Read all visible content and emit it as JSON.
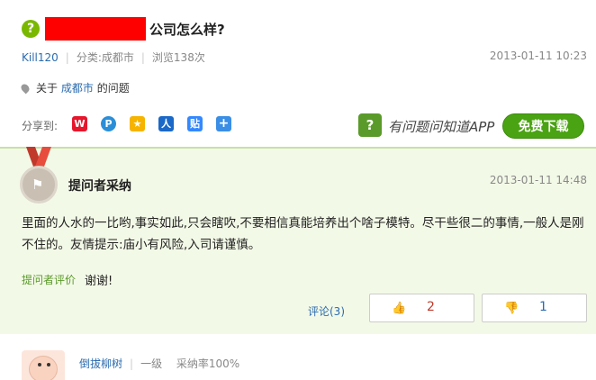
{
  "question": {
    "icon_glyph": "?",
    "title": "公司怎么样?",
    "redaction_color": "#ff0000"
  },
  "meta": {
    "user": "Kill120",
    "category": "分类:成都市",
    "views": "浏览138次",
    "time": "2013-01-11 10:23"
  },
  "about": {
    "prefix": "关于",
    "city": "成都市",
    "suffix": "的问题"
  },
  "share": {
    "label": "分享到:",
    "icons": [
      "weibo-icon",
      "qq-weibo-icon",
      "qzone-icon",
      "renren-icon",
      "tieba-icon",
      "more-share-icon"
    ]
  },
  "app": {
    "icon_glyph": "?",
    "text": "有问题问知道APP",
    "download_label": "免费下载",
    "accent": "#4aa312"
  },
  "best_answer": {
    "title": "提问者采纳",
    "time": "2013-01-11 14:48",
    "text": "里面的人水的一比哟,事实如此,只会瞎吹,不要相信真能培养出个啥子模特。尽干些很二的事情,一般人是刚不住的。友情提示:庙小有风险,入司请谨慎。",
    "eval_label": "提问者评价",
    "eval_text": "谢谢!",
    "comment_label": "评论(3)",
    "up_count": "2",
    "down_count": "1",
    "panel_color": "#f3f9e7"
  },
  "answerer": {
    "name": "倒拔柳树",
    "level": "一级",
    "adopt_rate": "采纳率100%"
  }
}
